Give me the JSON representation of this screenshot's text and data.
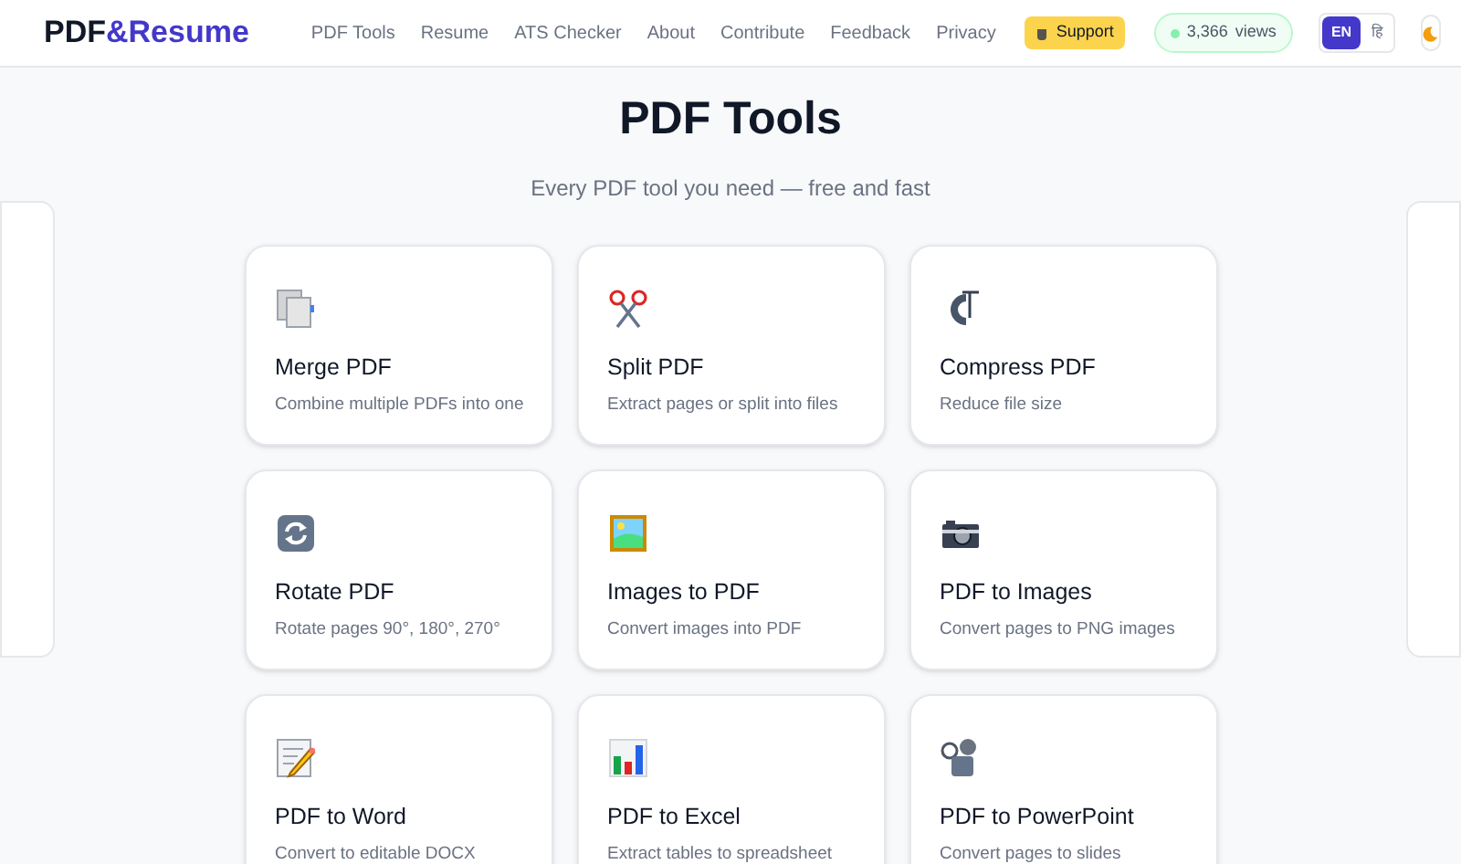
{
  "logo": {
    "part_1": "PDF",
    "part_2": "&Resume"
  },
  "nav": [
    {
      "label": "PDF Tools"
    },
    {
      "label": "Resume"
    },
    {
      "label": "ATS Checker"
    },
    {
      "label": "About"
    },
    {
      "label": "Contribute"
    },
    {
      "label": "Feedback"
    },
    {
      "label": "Privacy"
    }
  ],
  "support_button": {
    "label": "Support"
  },
  "views_badge": {
    "count": "3,366",
    "label": "views"
  },
  "languages": [
    {
      "label": "EN",
      "selected": true
    },
    {
      "label": "हि",
      "selected": false
    }
  ],
  "page": {
    "title": "PDF Tools",
    "subtitle": "Every PDF tool you need — free and fast"
  },
  "tools": [
    {
      "kind": "merge",
      "title": "Merge PDF",
      "description": "Combine multiple PDFs into one"
    },
    {
      "kind": "split",
      "title": "Split PDF",
      "description": "Extract pages or split into files"
    },
    {
      "kind": "compress",
      "title": "Compress PDF",
      "description": "Reduce file size"
    },
    {
      "kind": "rotate",
      "title": "Rotate PDF",
      "description": "Rotate pages 90°, 180°, 270°"
    },
    {
      "kind": "images",
      "title": "Images to PDF",
      "description": "Convert images into PDF"
    },
    {
      "kind": "camera",
      "title": "PDF to Images",
      "description": "Convert pages to PNG images"
    },
    {
      "kind": "word",
      "title": "PDF to Word",
      "description": "Convert to editable DOCX"
    },
    {
      "kind": "excel",
      "title": "PDF to Excel",
      "description": "Extract tables to spreadsheet"
    },
    {
      "kind": "powerpoint",
      "title": "PDF to PowerPoint",
      "description": "Convert pages to slides"
    }
  ]
}
